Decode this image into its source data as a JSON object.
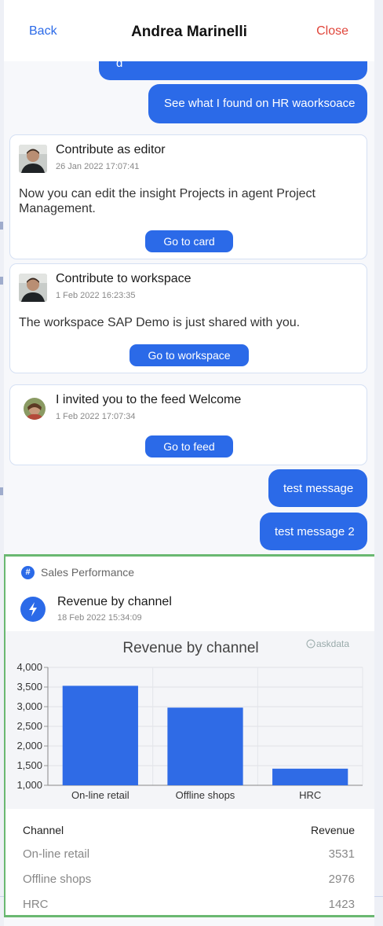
{
  "header": {
    "back_label": "Back",
    "title": "Andrea Marinelli",
    "close_label": "Close"
  },
  "messages": {
    "bubble_partial": "d",
    "bubble_found": "See what I found on HR waorksoace",
    "test1": "test message",
    "test2": "test message 2"
  },
  "cards": [
    {
      "title": "Contribute as editor",
      "time": "26 Jan 2022 17:07:41",
      "body": "Now you can edit the insight Projects in agent Project Management.",
      "button": "Go to card"
    },
    {
      "title": "Contribute to workspace",
      "time": "1 Feb 2022 16:23:35",
      "body": "The workspace SAP Demo is just shared with you.",
      "button": "Go to workspace"
    },
    {
      "title": "I invited you to the feed Welcome",
      "time": "1 Feb 2022 17:07:34",
      "button": "Go to feed"
    }
  ],
  "insight": {
    "workspace": "Sales Performance",
    "title": "Revenue by channel",
    "time": "18 Feb 2022 15:34:09",
    "brand": "askdata",
    "table": {
      "headers": [
        "Channel",
        "Revenue"
      ],
      "rows": [
        [
          "On-line retail",
          "3531"
        ],
        [
          "Offline shops",
          "2976"
        ],
        [
          "HRC",
          "1423"
        ]
      ]
    }
  },
  "colors": {
    "accent": "#2b6ae8",
    "highlight_border": "#6ab871",
    "close": "#e0463b"
  },
  "icons": {
    "hash": "hash-icon",
    "bolt": "lightning-icon",
    "brand": "askdata-logo-icon"
  },
  "chart_data": {
    "type": "bar",
    "title": "Revenue by channel",
    "categories": [
      "On-line retail",
      "Offline shops",
      "HRC"
    ],
    "values": [
      3531,
      2976,
      1423
    ],
    "yticks": [
      "1,000",
      "1,500",
      "2,000",
      "2,500",
      "3,000",
      "3,500",
      "4,000"
    ],
    "ylim": [
      1000,
      4000
    ],
    "grid": true,
    "xlabel": "",
    "ylabel": ""
  }
}
